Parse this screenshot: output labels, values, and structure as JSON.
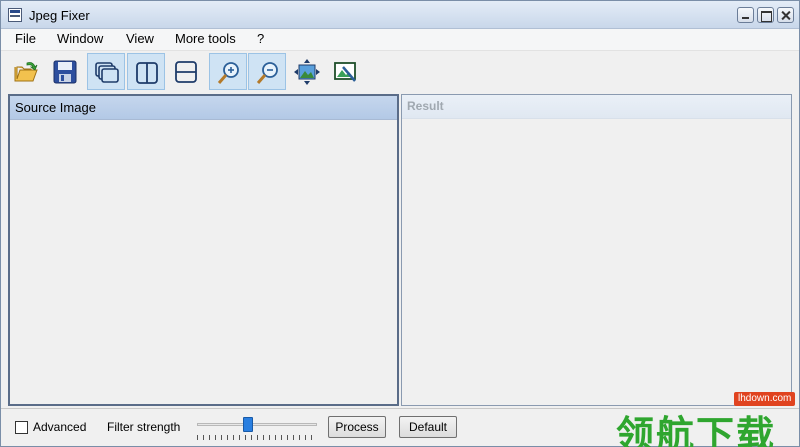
{
  "window": {
    "title": "Jpeg Fixer"
  },
  "menu": {
    "items": [
      "File",
      "Window",
      "View",
      "More tools",
      "?"
    ]
  },
  "toolbar": {
    "buttons": [
      {
        "name": "open-icon",
        "active": false
      },
      {
        "name": "save-icon",
        "active": false
      },
      {
        "name": "cascade-windows-icon",
        "active": true
      },
      {
        "name": "split-vertical-icon",
        "active": true
      },
      {
        "name": "split-horizontal-icon",
        "active": false
      },
      {
        "name": "zoom-in-icon",
        "active": true
      },
      {
        "name": "zoom-out-icon",
        "active": true
      },
      {
        "name": "fit-to-window-icon",
        "active": false
      },
      {
        "name": "edit-image-icon",
        "active": false
      }
    ]
  },
  "panes": {
    "source_title": "Source Image",
    "result_title": "Result"
  },
  "bottom": {
    "advanced_label": "Advanced",
    "advanced_checked": false,
    "filter_label": "Filter strength",
    "filter_value": 0.42,
    "process_label": "Process",
    "default_label": "Default"
  },
  "watermark": {
    "url": "lhdown.com",
    "text": "领航下载"
  },
  "colors": {
    "accent": "#2a7fe0",
    "header": "#c5d6ed",
    "watermark_green": "#2fa62f",
    "watermark_red": "#e0431f"
  }
}
